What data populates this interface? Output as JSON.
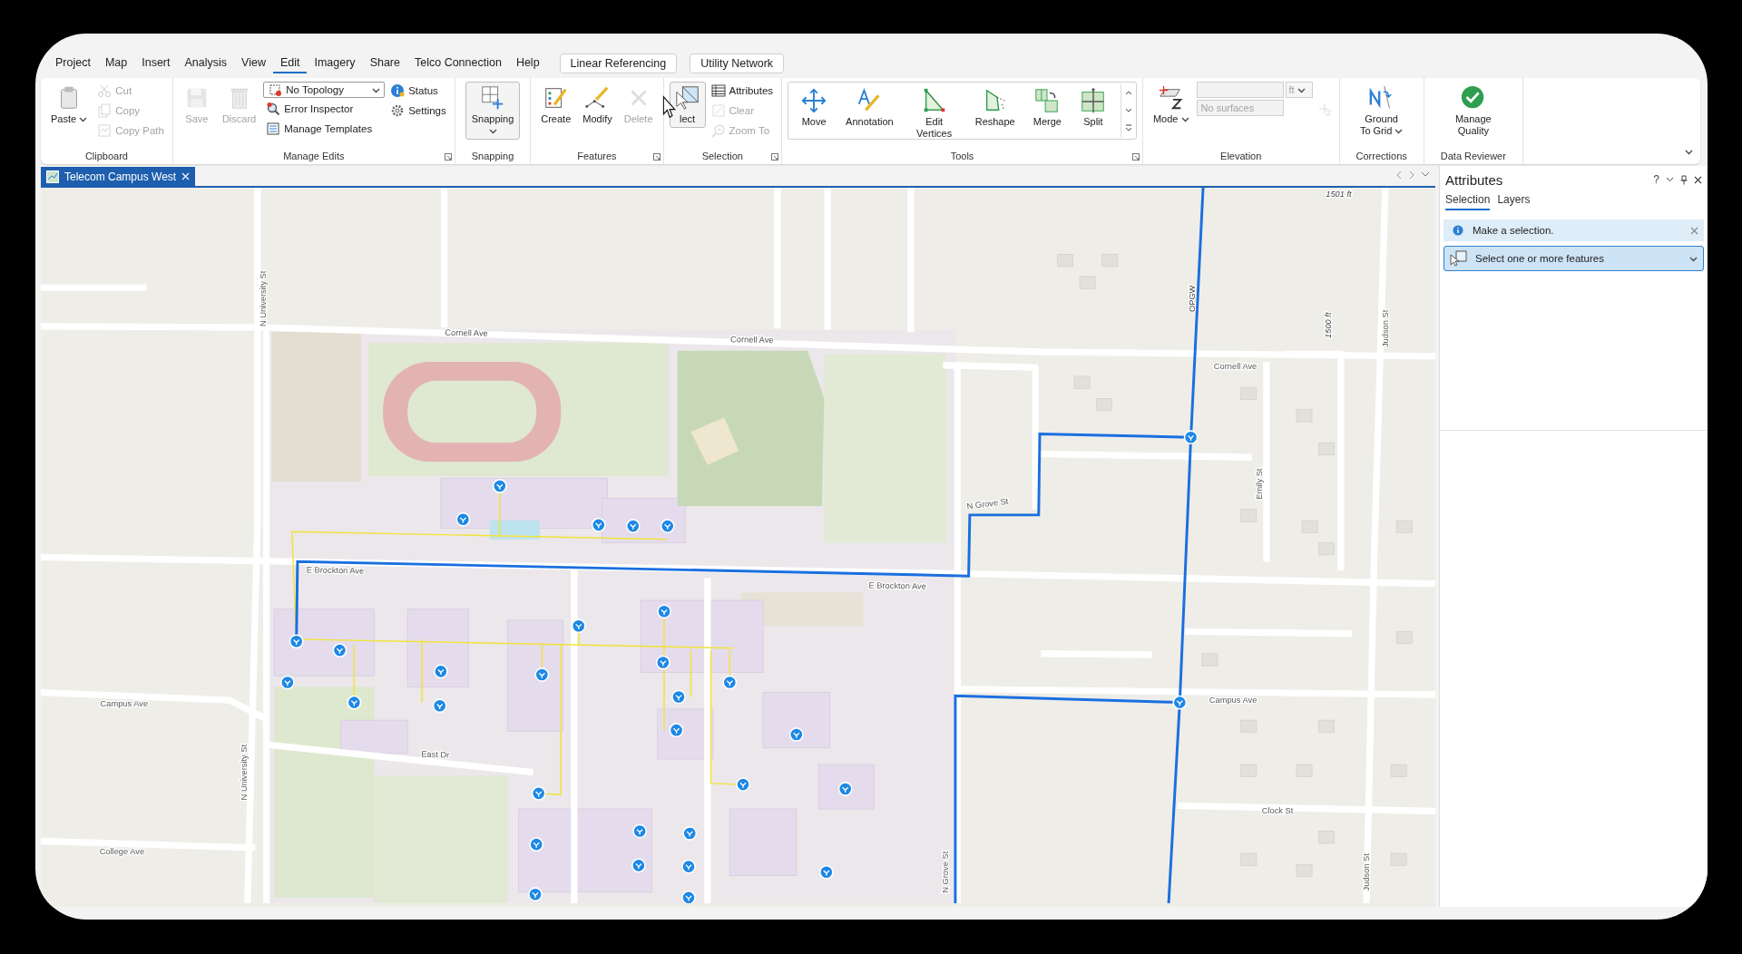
{
  "menu": {
    "tabs": [
      {
        "label": "Project",
        "selected": false
      },
      {
        "label": "Map",
        "selected": false
      },
      {
        "label": "Insert",
        "selected": false
      },
      {
        "label": "Analysis",
        "selected": false
      },
      {
        "label": "View",
        "selected": false
      },
      {
        "label": "Edit",
        "selected": true
      },
      {
        "label": "Imagery",
        "selected": false
      },
      {
        "label": "Share",
        "selected": false
      },
      {
        "label": "Telco Connection",
        "selected": false
      },
      {
        "label": "Help",
        "selected": false
      }
    ],
    "buttons": [
      "Linear Referencing",
      "Utility Network"
    ]
  },
  "ribbon": {
    "groups": [
      {
        "label": "Clipboard",
        "launcher": false,
        "gallery": false,
        "columns": [
          [
            {
              "kind": "large",
              "label": "Paste",
              "caret": true,
              "pressed": false,
              "disabled": false
            }
          ],
          [
            {
              "kind": "small",
              "label": "Cut",
              "disabled": true
            },
            {
              "kind": "small",
              "label": "Copy",
              "disabled": true
            },
            {
              "kind": "small",
              "label": "Copy Path",
              "disabled": true
            }
          ]
        ]
      },
      {
        "label": "Manage Edits",
        "launcher": true,
        "gallery": false,
        "columns": [
          [
            {
              "kind": "large",
              "label": "Save",
              "caret": false,
              "pressed": false,
              "disabled": true
            }
          ],
          [
            {
              "kind": "large",
              "label": "Discard",
              "caret": false,
              "pressed": false,
              "disabled": true
            }
          ],
          [
            {
              "kind": "dropdown",
              "label": "No Topology",
              "disabled": false
            },
            {
              "kind": "small",
              "label": "Error Inspector",
              "disabled": false
            },
            {
              "kind": "small",
              "label": "Manage Templates",
              "disabled": false
            }
          ],
          [
            {
              "kind": "small",
              "label": "Status",
              "disabled": false
            },
            {
              "kind": "small",
              "label": "Settings",
              "disabled": false
            }
          ]
        ]
      },
      {
        "label": "Snapping",
        "launcher": false,
        "gallery": false,
        "columns": [
          [
            {
              "kind": "large",
              "label": "Snapping",
              "caret": true,
              "pressed": true,
              "disabled": false
            }
          ]
        ]
      },
      {
        "label": "Features",
        "launcher": true,
        "gallery": false,
        "columns": [
          [
            {
              "kind": "large",
              "label": "Create",
              "caret": false,
              "pressed": false,
              "disabled": false
            }
          ],
          [
            {
              "kind": "large",
              "label": "Modify",
              "caret": false,
              "pressed": false,
              "disabled": false
            }
          ],
          [
            {
              "kind": "large",
              "label": "Delete",
              "caret": false,
              "pressed": false,
              "disabled": true
            }
          ]
        ]
      },
      {
        "label": "Selection",
        "launcher": true,
        "gallery": false,
        "columns": [
          [
            {
              "kind": "large",
              "label": "lect",
              "caret": false,
              "pressed": true,
              "disabled": false
            }
          ],
          [
            {
              "kind": "small",
              "label": "Attributes",
              "disabled": false
            },
            {
              "kind": "small",
              "label": "Clear",
              "disabled": true
            },
            {
              "kind": "small",
              "label": "Zoom To",
              "disabled": true
            }
          ]
        ]
      },
      {
        "label": "Tools",
        "launcher": true,
        "gallery": true,
        "columns": [
          [
            {
              "kind": "large",
              "label": "Move",
              "caret": false,
              "pressed": false,
              "disabled": false
            }
          ],
          [
            {
              "kind": "large",
              "label": "Annotation",
              "caret": false,
              "pressed": false,
              "disabled": false
            }
          ],
          [
            {
              "kind": "large",
              "label": "Edit Vertices",
              "caret": false,
              "pressed": false,
              "disabled": false
            }
          ],
          [
            {
              "kind": "large",
              "label": "Reshape",
              "caret": false,
              "pressed": false,
              "disabled": false
            }
          ],
          [
            {
              "kind": "large",
              "label": "Merge",
              "caret": false,
              "pressed": false,
              "disabled": false
            }
          ],
          [
            {
              "kind": "large",
              "label": "Split",
              "caret": false,
              "pressed": false,
              "disabled": false
            }
          ]
        ]
      },
      {
        "label": "Elevation",
        "launcher": false,
        "gallery": false,
        "columns": [
          [
            {
              "kind": "large",
              "label": "Mode",
              "caret": true,
              "pressed": false,
              "disabled": false
            }
          ],
          [
            {
              "kind": "unit-field",
              "label": "ft",
              "disabled": true
            },
            {
              "kind": "field",
              "label": "No surfaces",
              "disabled": true
            }
          ],
          [
            {
              "kind": "icon",
              "disabled": true
            }
          ]
        ]
      },
      {
        "label": "Corrections",
        "launcher": false,
        "gallery": false,
        "columns": [
          [
            {
              "kind": "large",
              "label": "Ground To Grid",
              "caret": true,
              "pressed": false,
              "disabled": false
            }
          ]
        ]
      },
      {
        "label": "Data Reviewer",
        "launcher": false,
        "gallery": false,
        "columns": [
          [
            {
              "kind": "large",
              "label": "Manage Quality",
              "caret": false,
              "pressed": false,
              "disabled": false
            }
          ]
        ]
      }
    ]
  },
  "document_tab": {
    "title": "Telecom Campus West"
  },
  "map": {
    "labels": [
      {
        "text": "1501 ft",
        "kind": "measure"
      },
      {
        "text": "OPGW",
        "kind": "line"
      },
      {
        "text": "N University St",
        "kind": "street"
      },
      {
        "text": "1500 ft",
        "kind": "measure"
      },
      {
        "text": "Judson St",
        "kind": "street"
      },
      {
        "text": "Cornell Ave",
        "kind": "street"
      },
      {
        "text": "Cornell Ave",
        "kind": "street"
      },
      {
        "text": "Cornell Ave",
        "kind": "street"
      },
      {
        "text": "Emily St",
        "kind": "street"
      },
      {
        "text": "N Grove St",
        "kind": "street"
      },
      {
        "text": "E Brockton Ave",
        "kind": "street"
      },
      {
        "text": "E Brockton Ave",
        "kind": "street"
      },
      {
        "text": "Campus Ave",
        "kind": "street"
      },
      {
        "text": "Campus Ave",
        "kind": "street"
      },
      {
        "text": "East Dr",
        "kind": "street"
      },
      {
        "text": "N University St",
        "kind": "street"
      },
      {
        "text": "Clock St",
        "kind": "street"
      },
      {
        "text": "College Ave",
        "kind": "street"
      },
      {
        "text": "N Grove St",
        "kind": "street"
      },
      {
        "text": "Judson St",
        "kind": "street"
      }
    ]
  },
  "attributes_pane": {
    "title": "Attributes",
    "help": "?",
    "tabs": [
      {
        "label": "Selection",
        "selected": true
      },
      {
        "label": "Layers",
        "selected": false
      }
    ],
    "message": "Make a selection.",
    "selector": "Select one or more features"
  }
}
